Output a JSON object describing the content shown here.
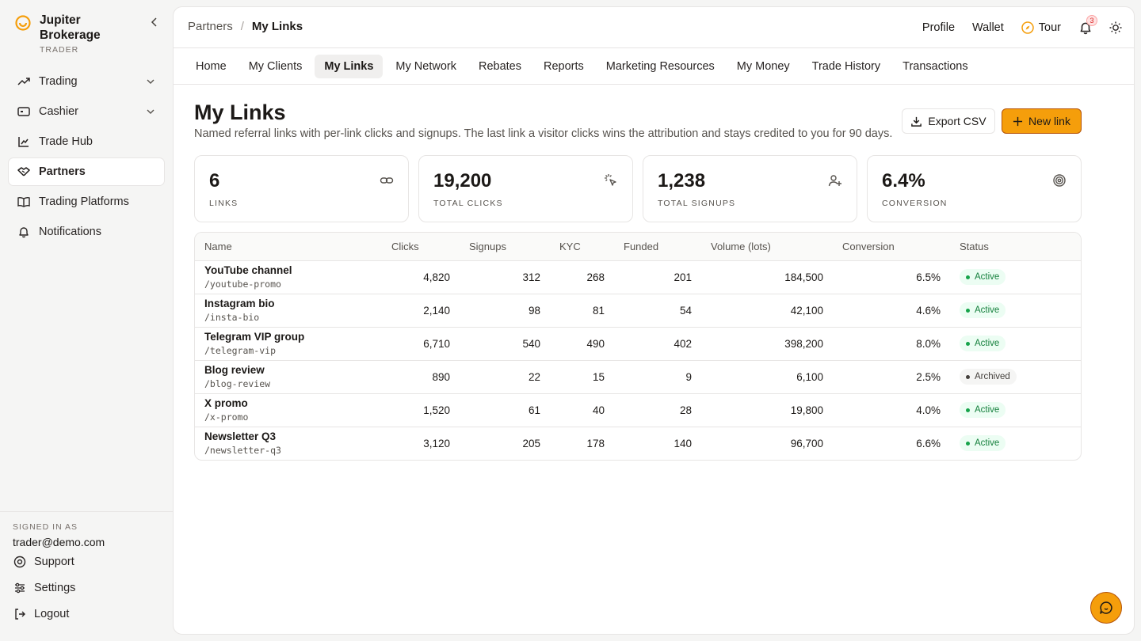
{
  "brand": {
    "name": "Jupiter Brokerage",
    "role": "TRADER",
    "accent": "#f59e0b"
  },
  "sidebar": {
    "items": [
      {
        "label": "Trading",
        "icon": "trend-up-icon",
        "expandable": true
      },
      {
        "label": "Cashier",
        "icon": "wallet-card-icon",
        "expandable": true
      },
      {
        "label": "Trade Hub",
        "icon": "chart-icon",
        "expandable": false
      },
      {
        "label": "Partners",
        "icon": "handshake-icon",
        "expandable": false,
        "active": true
      },
      {
        "label": "Trading Platforms",
        "icon": "book-icon",
        "expandable": false
      },
      {
        "label": "Notifications",
        "icon": "bell-icon",
        "expandable": false
      }
    ],
    "signed_in_label": "SIGNED IN AS",
    "email": "trader@demo.com",
    "footer_links": [
      {
        "label": "Support",
        "icon": "life-buoy-icon"
      },
      {
        "label": "Settings",
        "icon": "sliders-icon"
      },
      {
        "label": "Logout",
        "icon": "logout-icon"
      }
    ]
  },
  "topbar": {
    "breadcrumb_parent": "Partners",
    "breadcrumb_current": "My Links",
    "profile": "Profile",
    "wallet": "Wallet",
    "tour": "Tour",
    "notification_count": "3"
  },
  "tabs": [
    "Home",
    "My Clients",
    "My Links",
    "My Network",
    "Rebates",
    "Reports",
    "Marketing Resources",
    "My Money",
    "Trade History",
    "Transactions"
  ],
  "active_tab": "My Links",
  "page": {
    "title": "My Links",
    "description": "Named referral links with per-link clicks and signups. The last link a visitor clicks wins the attribution and stays credited to you for 90 days.",
    "export_label": "Export CSV",
    "new_label": "New link"
  },
  "stats": [
    {
      "value": "6",
      "label": "LINKS",
      "icon": "link-icon"
    },
    {
      "value": "19,200",
      "label": "TOTAL CLICKS",
      "icon": "pointer-click-icon"
    },
    {
      "value": "1,238",
      "label": "TOTAL SIGNUPS",
      "icon": "user-plus-icon"
    },
    {
      "value": "6.4%",
      "label": "CONVERSION",
      "icon": "target-icon"
    }
  ],
  "table": {
    "headers": [
      "Name",
      "Clicks",
      "Signups",
      "KYC",
      "Funded",
      "Volume (lots)",
      "Conversion",
      "Status"
    ],
    "rows": [
      {
        "name": "YouTube channel",
        "slug": "/youtube-promo",
        "clicks": "4,820",
        "signups": "312",
        "kyc": "268",
        "funded": "201",
        "volume": "184,500",
        "conversion": "6.5%",
        "status": "Active"
      },
      {
        "name": "Instagram bio",
        "slug": "/insta-bio",
        "clicks": "2,140",
        "signups": "98",
        "kyc": "81",
        "funded": "54",
        "volume": "42,100",
        "conversion": "4.6%",
        "status": "Active"
      },
      {
        "name": "Telegram VIP group",
        "slug": "/telegram-vip",
        "clicks": "6,710",
        "signups": "540",
        "kyc": "490",
        "funded": "402",
        "volume": "398,200",
        "conversion": "8.0%",
        "status": "Active"
      },
      {
        "name": "Blog review",
        "slug": "/blog-review",
        "clicks": "890",
        "signups": "22",
        "kyc": "15",
        "funded": "9",
        "volume": "6,100",
        "conversion": "2.5%",
        "status": "Archived"
      },
      {
        "name": "X promo",
        "slug": "/x-promo",
        "clicks": "1,520",
        "signups": "61",
        "kyc": "40",
        "funded": "28",
        "volume": "19,800",
        "conversion": "4.0%",
        "status": "Active"
      },
      {
        "name": "Newsletter Q3",
        "slug": "/newsletter-q3",
        "clicks": "3,120",
        "signups": "205",
        "kyc": "178",
        "funded": "140",
        "volume": "96,700",
        "conversion": "6.6%",
        "status": "Active"
      }
    ]
  }
}
